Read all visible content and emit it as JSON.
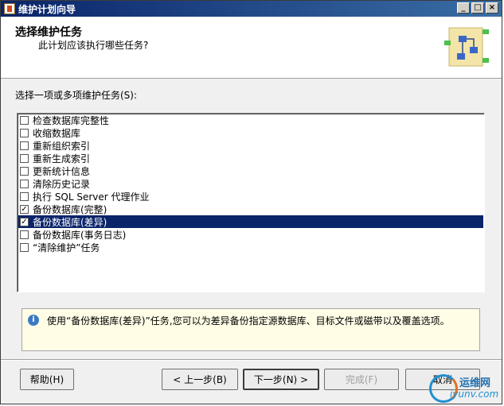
{
  "window": {
    "title": "维护计划向导"
  },
  "window_controls": {
    "minimize": "_",
    "maximize": "□",
    "close": "×"
  },
  "header": {
    "title": "选择维护任务",
    "subtitle": "此计划应该执行哪些任务?"
  },
  "tasks": {
    "label": "选择一项或多项维护任务(S):",
    "items": [
      {
        "label": "检查数据库完整性",
        "checked": false,
        "mark": ""
      },
      {
        "label": "收缩数据库",
        "checked": false,
        "mark": ""
      },
      {
        "label": "重新组织索引",
        "checked": false,
        "mark": ""
      },
      {
        "label": "重新生成索引",
        "checked": false,
        "mark": ""
      },
      {
        "label": "更新统计信息",
        "checked": false,
        "mark": ""
      },
      {
        "label": "清除历史记录",
        "checked": false,
        "mark": ""
      },
      {
        "label": "执行 SQL Server 代理作业",
        "checked": false,
        "mark": ""
      },
      {
        "label": "备份数据库(完整)",
        "checked": true,
        "mark": "✓"
      },
      {
        "label": "备份数据库(差异)",
        "checked": true,
        "mark": "✓",
        "selected": true
      },
      {
        "label": "备份数据库(事务日志)",
        "checked": false,
        "mark": ""
      },
      {
        "label": "“清除维护”任务",
        "checked": false,
        "mark": ""
      }
    ]
  },
  "info": {
    "text": "使用“备份数据库(差异)”任务,您可以为差异备份指定源数据库、目标文件或磁带以及覆盖选项。"
  },
  "buttons": {
    "help": "帮助(H)",
    "back": "< 上一步(B)",
    "next": "下一步(N) >",
    "finish": "完成(F)",
    "cancel": "取消"
  },
  "watermark": {
    "cn": "运维网",
    "en": "iyunv.com"
  },
  "colors": {
    "selection": "#0a246a",
    "title_bar": "#0a246a",
    "info_bg": "#fffde6"
  }
}
